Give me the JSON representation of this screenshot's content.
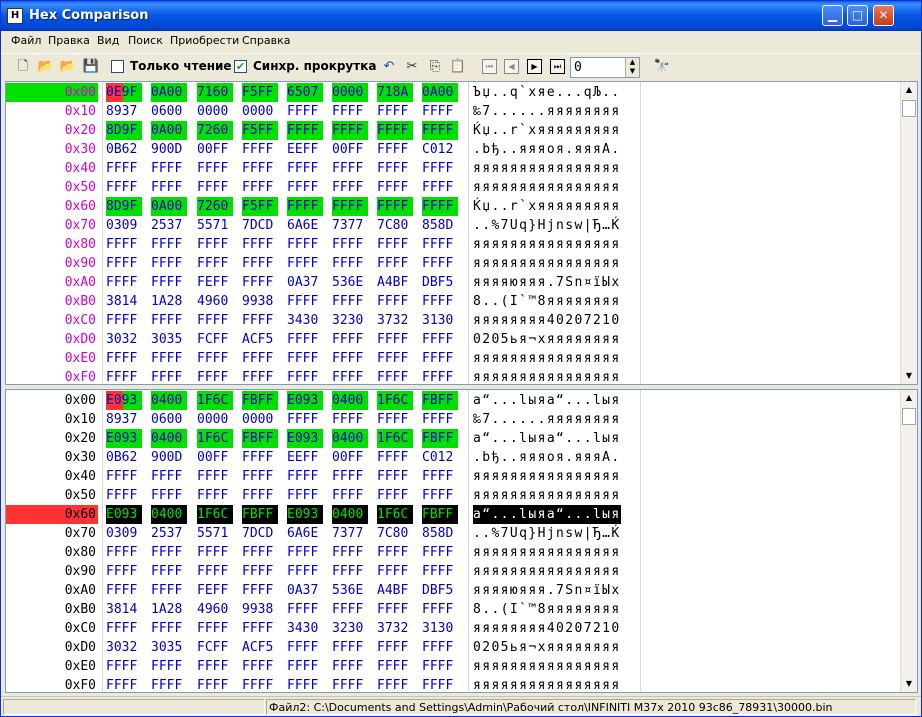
{
  "window": {
    "title": "Hex Comparison",
    "icon_text": "H"
  },
  "menu": [
    "Файл",
    "Правка",
    "Вид",
    "Поиск",
    "Приобрести",
    "Справка"
  ],
  "toolbar": {
    "readonly_label": "Только чтение",
    "readonly_checked": false,
    "syncscroll_label": "Синхр. прокрутка",
    "syncscroll_checked": true,
    "offset_value": "0"
  },
  "status": {
    "file2": "Файл2: C:\\Documents and Settings\\Admin\\Рабочий стол\\INFINITI M37x 2010 93c86_78931\\30000.bin"
  },
  "colors": {
    "addr": "#d400d4",
    "hex": "#0000c8",
    "diff": "#00e000",
    "cursor": "#ff3333",
    "selected_row": "#000000"
  },
  "pane1": {
    "rows": [
      {
        "addr": "0x00",
        "words": [
          "0E9F",
          "0A00",
          "7160",
          "F5FF",
          "6507",
          "0000",
          "718A",
          "0A00"
        ],
        "ascii": "Ъџ..q`хяе...qЉ..",
        "addr_highlight": true
      },
      {
        "addr": "0x10",
        "words": [
          "8937",
          "0600",
          "0000",
          "0000",
          "FFFF",
          "FFFF",
          "FFFF",
          "FFFF"
        ],
        "ascii": "‰7......яяяяяяяя"
      },
      {
        "addr": "0x20",
        "words": [
          "8D9F",
          "0A00",
          "7260",
          "F5FF",
          "FFFF",
          "FFFF",
          "FFFF",
          "FFFF"
        ],
        "ascii": "Ќџ..r`хяяяяяяяяя"
      },
      {
        "addr": "0x30",
        "words": [
          "0B62",
          "900D",
          "00FF",
          "FFFF",
          "EEFF",
          "00FF",
          "FFFF",
          "C012"
        ],
        "ascii": ".bђ..яяяоя.яяяА."
      },
      {
        "addr": "0x40",
        "words": [
          "FFFF",
          "FFFF",
          "FFFF",
          "FFFF",
          "FFFF",
          "FFFF",
          "FFFF",
          "FFFF"
        ],
        "ascii": "яяяяяяяяяяяяяяяя"
      },
      {
        "addr": "0x50",
        "words": [
          "FFFF",
          "FFFF",
          "FFFF",
          "FFFF",
          "FFFF",
          "FFFF",
          "FFFF",
          "FFFF"
        ],
        "ascii": "яяяяяяяяяяяяяяяя"
      },
      {
        "addr": "0x60",
        "words": [
          "8D9F",
          "0A00",
          "7260",
          "F5FF",
          "FFFF",
          "FFFF",
          "FFFF",
          "FFFF"
        ],
        "ascii": "Ќџ..r`хяяяяяяяяя"
      },
      {
        "addr": "0x70",
        "words": [
          "0309",
          "2537",
          "5571",
          "7DCD",
          "6A6E",
          "7377",
          "7C80",
          "858D"
        ],
        "ascii": "..%7Uq}Hjnsw|Ђ…Ќ"
      },
      {
        "addr": "0x80",
        "words": [
          "FFFF",
          "FFFF",
          "FFFF",
          "FFFF",
          "FFFF",
          "FFFF",
          "FFFF",
          "FFFF"
        ],
        "ascii": "яяяяяяяяяяяяяяяя"
      },
      {
        "addr": "0x90",
        "words": [
          "FFFF",
          "FFFF",
          "FFFF",
          "FFFF",
          "FFFF",
          "FFFF",
          "FFFF",
          "FFFF"
        ],
        "ascii": "яяяяяяяяяяяяяяяя"
      },
      {
        "addr": "0xA0",
        "words": [
          "FFFF",
          "FFFF",
          "FEFF",
          "FFFF",
          "0A37",
          "536E",
          "A4BF",
          "DBF5"
        ],
        "ascii": "яяяяюяяя.7Sn¤їЫх"
      },
      {
        "addr": "0xB0",
        "words": [
          "3814",
          "1A28",
          "4960",
          "9938",
          "FFFF",
          "FFFF",
          "FFFF",
          "FFFF"
        ],
        "ascii": "8..(I`™8яяяяяяяя"
      },
      {
        "addr": "0xC0",
        "words": [
          "FFFF",
          "FFFF",
          "FFFF",
          "FFFF",
          "3430",
          "3230",
          "3732",
          "3130"
        ],
        "ascii": "яяяяяяяя40207210"
      },
      {
        "addr": "0xD0",
        "words": [
          "3032",
          "3035",
          "FCFF",
          "ACF5",
          "FFFF",
          "FFFF",
          "FFFF",
          "FFFF"
        ],
        "ascii": "0205ья¬хяяяяяяяя"
      },
      {
        "addr": "0xE0",
        "words": [
          "FFFF",
          "FFFF",
          "FFFF",
          "FFFF",
          "FFFF",
          "FFFF",
          "FFFF",
          "FFFF"
        ],
        "ascii": "яяяяяяяяяяяяяяяя"
      },
      {
        "addr": "0xF0",
        "words": [
          "FFFF",
          "FFFF",
          "FFFF",
          "FFFF",
          "FFFF",
          "FFFF",
          "FFFF",
          "FFFF"
        ],
        "ascii": "яяяяяяяяяяяяяяяя"
      }
    ],
    "diff_rows": [
      0,
      2,
      6
    ]
  },
  "pane2": {
    "rows": [
      {
        "addr": "0x00",
        "words": [
          "E093",
          "0400",
          "1F6C",
          "FBFF",
          "E093",
          "0400",
          "1F6C",
          "FBFF"
        ],
        "ascii": "а“...lыяа“...lыя"
      },
      {
        "addr": "0x10",
        "words": [
          "8937",
          "0600",
          "0000",
          "0000",
          "FFFF",
          "FFFF",
          "FFFF",
          "FFFF"
        ],
        "ascii": "‰7......яяяяяяяя"
      },
      {
        "addr": "0x20",
        "words": [
          "E093",
          "0400",
          "1F6C",
          "FBFF",
          "E093",
          "0400",
          "1F6C",
          "FBFF"
        ],
        "ascii": "а“...lыяа“...lыя"
      },
      {
        "addr": "0x30",
        "words": [
          "0B62",
          "900D",
          "00FF",
          "FFFF",
          "EEFF",
          "00FF",
          "FFFF",
          "C012"
        ],
        "ascii": ".bђ..яяяоя.яяяА."
      },
      {
        "addr": "0x40",
        "words": [
          "FFFF",
          "FFFF",
          "FFFF",
          "FFFF",
          "FFFF",
          "FFFF",
          "FFFF",
          "FFFF"
        ],
        "ascii": "яяяяяяяяяяяяяяяя"
      },
      {
        "addr": "0x50",
        "words": [
          "FFFF",
          "FFFF",
          "FFFF",
          "FFFF",
          "FFFF",
          "FFFF",
          "FFFF",
          "FFFF"
        ],
        "ascii": "яяяяяяяяяяяяяяяя"
      },
      {
        "addr": "0x60",
        "words": [
          "E093",
          "0400",
          "1F6C",
          "FBFF",
          "E093",
          "0400",
          "1F6C",
          "FBFF"
        ],
        "ascii": "а“...lыяа“...lыя",
        "addr_highlight": true,
        "selected": true
      },
      {
        "addr": "0x70",
        "words": [
          "0309",
          "2537",
          "5571",
          "7DCD",
          "6A6E",
          "7377",
          "7C80",
          "858D"
        ],
        "ascii": "..%7Uq}Hjnsw|Ђ…Ќ"
      },
      {
        "addr": "0x80",
        "words": [
          "FFFF",
          "FFFF",
          "FFFF",
          "FFFF",
          "FFFF",
          "FFFF",
          "FFFF",
          "FFFF"
        ],
        "ascii": "яяяяяяяяяяяяяяяя"
      },
      {
        "addr": "0x90",
        "words": [
          "FFFF",
          "FFFF",
          "FFFF",
          "FFFF",
          "FFFF",
          "FFFF",
          "FFFF",
          "FFFF"
        ],
        "ascii": "яяяяяяяяяяяяяяяя"
      },
      {
        "addr": "0xA0",
        "words": [
          "FFFF",
          "FFFF",
          "FEFF",
          "FFFF",
          "0A37",
          "536E",
          "A4BF",
          "DBF5"
        ],
        "ascii": "яяяяюяяя.7Sn¤їЫх"
      },
      {
        "addr": "0xB0",
        "words": [
          "3814",
          "1A28",
          "4960",
          "9938",
          "FFFF",
          "FFFF",
          "FFFF",
          "FFFF"
        ],
        "ascii": "8..(I`™8яяяяяяяя"
      },
      {
        "addr": "0xC0",
        "words": [
          "FFFF",
          "FFFF",
          "FFFF",
          "FFFF",
          "3430",
          "3230",
          "3732",
          "3130"
        ],
        "ascii": "яяяяяяяя40207210"
      },
      {
        "addr": "0xD0",
        "words": [
          "3032",
          "3035",
          "FCFF",
          "ACF5",
          "FFFF",
          "FFFF",
          "FFFF",
          "FFFF"
        ],
        "ascii": "0205ья¬хяяяяяяяя"
      },
      {
        "addr": "0xE0",
        "words": [
          "FFFF",
          "FFFF",
          "FFFF",
          "FFFF",
          "FFFF",
          "FFFF",
          "FFFF",
          "FFFF"
        ],
        "ascii": "яяяяяяяяяяяяяяяя"
      },
      {
        "addr": "0xF0",
        "words": [
          "FFFF",
          "FFFF",
          "FFFF",
          "FFFF",
          "FFFF",
          "FFFF",
          "FFFF",
          "FFFF"
        ],
        "ascii": "яяяяяяяяяяяяяяяя"
      }
    ],
    "diff_rows": [
      0,
      2,
      6
    ]
  }
}
